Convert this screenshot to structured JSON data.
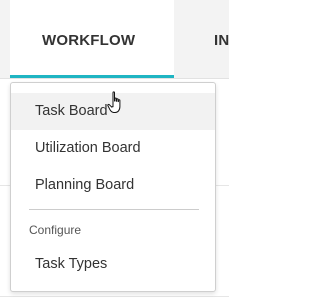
{
  "nav": {
    "tabs": [
      {
        "label": "WORKFLOW",
        "active": true
      },
      {
        "label": "IN",
        "active": false
      }
    ],
    "accent_color": "#1fb5c3"
  },
  "dropdown": {
    "items": [
      {
        "label": "Task Board",
        "hovered": true
      },
      {
        "label": "Utilization Board"
      },
      {
        "label": "Planning Board"
      }
    ],
    "configure_section": {
      "label": "Configure",
      "items": [
        {
          "label": "Task Types"
        }
      ]
    }
  },
  "cursor": {
    "icon": "hand-pointer-icon"
  }
}
